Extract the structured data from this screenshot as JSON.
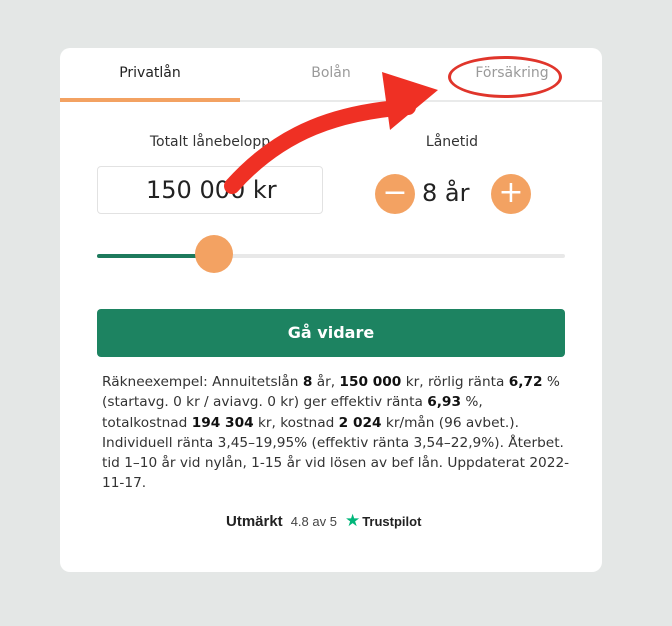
{
  "tabs": [
    {
      "label": "Privatlån",
      "active": true
    },
    {
      "label": "Bolån",
      "active": false
    },
    {
      "label": "Försäkring",
      "active": false
    }
  ],
  "calculator": {
    "amount_label": "Totalt lånebelopp",
    "amount_value": "150 000 kr",
    "term_label": "Lånetid",
    "term_value": "8 år",
    "minus_symbol": "−",
    "plus_symbol": "+",
    "slider_fraction": 0.25,
    "submit_label": "Gå vidare"
  },
  "example": {
    "p1": "Räkneexempel: Annuitetslån ",
    "b1": "8",
    "p2": " år, ",
    "b2": "150 000",
    "p3": " kr, rörlig ränta ",
    "b3": "6,72",
    "p4": " % (startavg. 0 kr / aviavg. 0 kr) ger effektiv ränta ",
    "b4": "6,93",
    "p5": " %, totalkostnad ",
    "b5": "194 304",
    "p6": " kr, kostnad ",
    "b6": "2 024",
    "p7": " kr/mån (96 avbet.). Individuell ränta 3,45–19,95% (effektiv ränta 3,54–22,9%). Återbet. tid 1–10 år vid nylån, 1-15 år vid lösen av bef lån. Uppdaterat 2022-11-17."
  },
  "trustpilot": {
    "rating_word": "Utmärkt",
    "score": "4.8 av 5",
    "star": "★",
    "brand": "Trustpilot"
  },
  "colors": {
    "accent_orange": "#f3a262",
    "primary_green": "#1d8361",
    "annotation_red": "#e0352b",
    "trustpilot_green": "#00b67a"
  }
}
